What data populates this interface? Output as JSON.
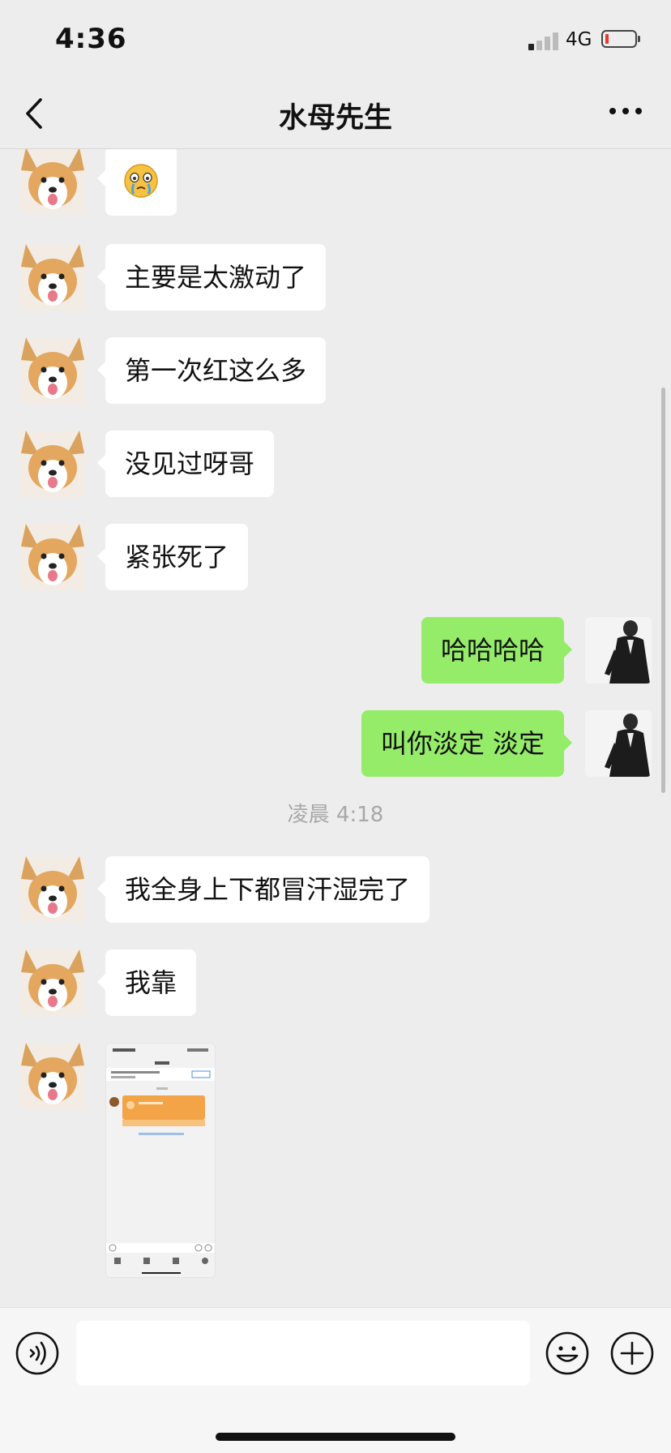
{
  "status_bar": {
    "time": "4:36",
    "network": "4G"
  },
  "header": {
    "title": "水母先生"
  },
  "messages": [
    {
      "type": "emoji",
      "from": "contact",
      "emoji": "😢"
    },
    {
      "type": "text",
      "from": "contact",
      "text": "主要是太激动了"
    },
    {
      "type": "text",
      "from": "contact",
      "text": "第一次红这么多"
    },
    {
      "type": "text",
      "from": "contact",
      "text": "没见过呀哥"
    },
    {
      "type": "text",
      "from": "contact",
      "text": "紧张死了"
    },
    {
      "type": "text",
      "from": "me",
      "text": "哈哈哈哈"
    },
    {
      "type": "text",
      "from": "me",
      "text": "叫你淡定 淡定"
    },
    {
      "type": "timestamp",
      "text": "凌晨 4:18"
    },
    {
      "type": "text",
      "from": "contact",
      "text": "我全身上下都冒汗湿完了"
    },
    {
      "type": "text",
      "from": "contact",
      "text": "我靠"
    },
    {
      "type": "image",
      "from": "contact"
    }
  ],
  "input": {
    "value": "",
    "placeholder": ""
  },
  "colors": {
    "background": "#ededed",
    "outgoing_bubble": "#95ec69",
    "incoming_bubble": "#ffffff",
    "timestamp": "#a8a8a8",
    "battery_low": "#e53935"
  },
  "icons": [
    "back-icon",
    "more-icon",
    "voice-icon",
    "emoji-icon",
    "plus-icon"
  ]
}
